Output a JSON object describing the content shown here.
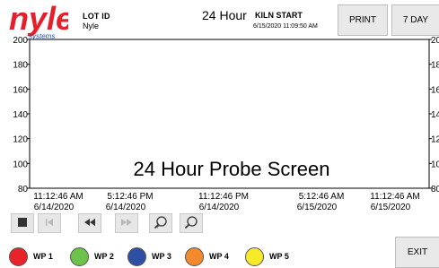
{
  "header": {
    "logo_text": "nyle",
    "logo_sub": "systems",
    "lot_label": "LOT ID",
    "lot_value": "Nyle",
    "period_title": "24 Hour",
    "kiln_label": "KILN START",
    "kiln_time": "6/15/2020 11:09:50 AM",
    "print_label": "PRINT",
    "seven_day_label": "7 DAY"
  },
  "chart_data": {
    "type": "line",
    "title": "24 Hour Probe Screen",
    "ylim": [
      80,
      200
    ],
    "yticks_left": [
      "200",
      "180",
      "160",
      "140",
      "120",
      "100",
      "80"
    ],
    "yticks_right": [
      "20",
      "18",
      "16",
      "14",
      "12",
      "10",
      "80"
    ],
    "x_ticks": [
      {
        "time": "11:12:46 AM",
        "date": "6/14/2020"
      },
      {
        "time": "5:12:46 PM",
        "date": "6/14/2020"
      },
      {
        "time": "11:12:46 PM",
        "date": "6/14/2020"
      },
      {
        "time": "5:12:46 AM",
        "date": "6/15/2020"
      },
      {
        "time": "11:12:46 AM",
        "date": "6/15/2020"
      }
    ],
    "series": []
  },
  "controls": [
    {
      "name": "stop-button",
      "icon": "stop-icon",
      "glyph": "■",
      "enabled": true
    },
    {
      "name": "first-button",
      "icon": "skip-to-start-icon",
      "glyph": "⏮",
      "enabled": false
    },
    {
      "name": "rewind-button",
      "icon": "rewind-icon",
      "glyph": "⏪",
      "enabled": true
    },
    {
      "name": "forward-button",
      "icon": "fast-forward-icon",
      "glyph": "⏩",
      "enabled": false
    },
    {
      "name": "zoom-in-button",
      "icon": "zoom-in-icon",
      "glyph": "+",
      "enabled": true
    },
    {
      "name": "zoom-out-button",
      "icon": "zoom-out-icon",
      "glyph": "-",
      "enabled": true
    }
  ],
  "legend": [
    {
      "label": "WP 1",
      "color": "#e8232a"
    },
    {
      "label": "WP 2",
      "color": "#6cc24a"
    },
    {
      "label": "WP 3",
      "color": "#2e4fa3"
    },
    {
      "label": "WP 4",
      "color": "#f58a2d"
    },
    {
      "label": "WP 5",
      "color": "#f7ea2b"
    }
  ],
  "exit_label": "EXIT",
  "colors": {
    "brand_red": "#e4202b",
    "brand_blue": "#1c4f9c",
    "button_bg": "#e9e9e9"
  }
}
